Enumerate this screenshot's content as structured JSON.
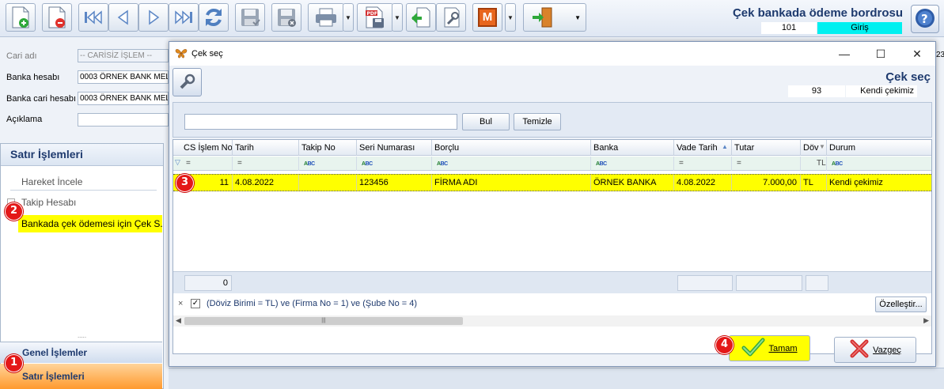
{
  "toolbar": {
    "doc_title": "Çek bankada ödeme bordrosu",
    "doc_number": "101",
    "doc_type": "Giriş",
    "export_badge": "PDF",
    "m_label": "M"
  },
  "form": {
    "cari_adi_label": "Cari adı",
    "cari_adi_value": "-- CARİSİZ İŞLEM --",
    "banka_hesabi_label": "Banka hesabı",
    "banka_hesabi_value": "0003 ÖRNEK BANK MEL",
    "banka_cari_label": "Banka cari hesabı",
    "banka_cari_value": "0003 ÖRNEK BANK MEL",
    "aciklama_label": "Açıklama",
    "right_edge_value": "23"
  },
  "left_panel": {
    "header": "Satır İşlemleri",
    "items": [
      "Hareket İncele",
      "Takip Hesabı"
    ],
    "highlighted_item": "Bankada çek ödemesi için Çek S...",
    "splitter_dots": ".....",
    "nav_genel": "Genel İşlemler",
    "nav_satir": "Satır İşlemleri"
  },
  "dialog": {
    "title": "Çek seç",
    "heading": "Çek seç",
    "number": "93",
    "type": "Kendi çekimiz",
    "search_value": "",
    "find_label": "Bul",
    "clear_label": "Temizle",
    "columns": [
      "CS İşlem No",
      "Tarih",
      "Takip No",
      "Seri Numarası",
      "Borçlu",
      "Banka",
      "Vade Tarih",
      "Tutar",
      "Döv",
      "Durum"
    ],
    "filter_row": {
      "cs_islem_no": "=",
      "tarih": "=",
      "vade_tarih": "=",
      "tutar": "=",
      "doviz": "TL"
    },
    "rows": [
      {
        "cs_islem_no": "11",
        "tarih": "4.08.2022",
        "takip_no": "",
        "seri_numarasi": "123456",
        "borclu": "FİRMA ADI",
        "banka": "ÖRNEK BANKA",
        "vade_tarih": "4.08.2022",
        "tutar": "7.000,00",
        "doviz": "TL",
        "durum": "Kendi çekimiz"
      }
    ],
    "footer_count": "0",
    "filter_close": "×",
    "filter_checked": "✓",
    "filter_expression": "(Döviz Birimi = TL) ve (Firma No = 1) ve (Şube No = 4)",
    "customize_label": "Özelleştir...",
    "ok_label": "Tamam",
    "cancel_label": "Vazgeç"
  },
  "markers": [
    "1",
    "2",
    "3",
    "4"
  ],
  "colors": {
    "highlight": "#ffff00",
    "doc_type_bg": "#00f0f0",
    "title_blue": "#1e3a6e",
    "active_nav": "#ff9a2e",
    "marker_red": "#e41818"
  }
}
